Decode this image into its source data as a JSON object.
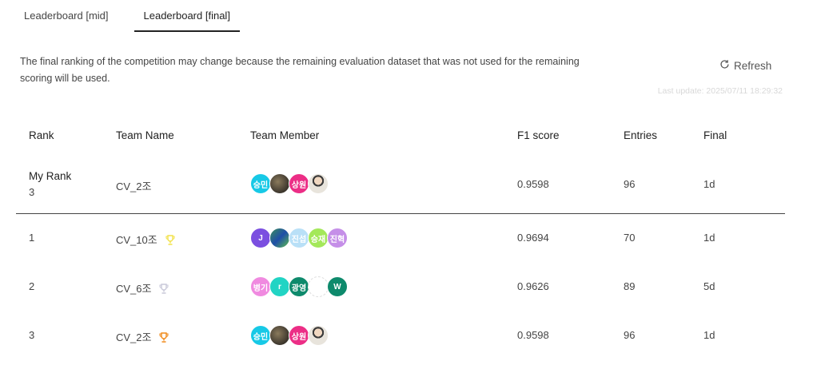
{
  "tabs": [
    {
      "label": "Leaderboard [mid]"
    },
    {
      "label": "Leaderboard [final]"
    }
  ],
  "notice": "The final ranking of the competition may change because the remaining evaluation dataset that was not used for the remaining scoring will be used.",
  "refresh_label": "Refresh",
  "last_update": "Last update: 2025/07/11 18:29:32",
  "columns": {
    "rank": "Rank",
    "team_name": "Team Name",
    "team_member": "Team Member",
    "f1": "F1 score",
    "entries": "Entries",
    "final": "Final"
  },
  "my_rank": {
    "label": "My Rank",
    "rank": "3",
    "team": "CV_2조",
    "members": [
      {
        "text": "승민",
        "color": "#17c9e6"
      },
      {
        "text": "",
        "color": "photo-dark"
      },
      {
        "text": "상원",
        "color": "#ec2e86"
      },
      {
        "text": "",
        "color": "photo-man"
      }
    ],
    "f1": "0.9598",
    "entries": "96",
    "final": "1d"
  },
  "rows": [
    {
      "rank": "1",
      "team": "CV_10조",
      "trophy_color": "#f2e24a",
      "members": [
        {
          "text": "J",
          "color": "#7b4fe0"
        },
        {
          "text": "",
          "color": "photo-green"
        },
        {
          "text": "진섭",
          "color": "#b9e0f7"
        },
        {
          "text": "승재",
          "color": "#a4e85a"
        },
        {
          "text": "진혁",
          "color": "#c58fe8"
        }
      ],
      "f1": "0.9694",
      "entries": "70",
      "final": "1d"
    },
    {
      "rank": "2",
      "team": "CV_6조",
      "trophy_color": "#c9c9d9",
      "members": [
        {
          "text": "병기",
          "color": "#f08ae0"
        },
        {
          "text": "r",
          "color": "#22d4c4"
        },
        {
          "text": "광영",
          "color": "#0e8a6c"
        },
        {
          "text": "",
          "color": "photo-blank"
        },
        {
          "text": "W",
          "color": "#0e8a6c"
        }
      ],
      "f1": "0.9626",
      "entries": "89",
      "final": "5d"
    },
    {
      "rank": "3",
      "team": "CV_2조",
      "trophy_color": "#f08a1a",
      "members": [
        {
          "text": "승민",
          "color": "#17c9e6"
        },
        {
          "text": "",
          "color": "photo-dark"
        },
        {
          "text": "상원",
          "color": "#ec2e86"
        },
        {
          "text": "",
          "color": "photo-man"
        }
      ],
      "f1": "0.9598",
      "entries": "96",
      "final": "1d"
    }
  ]
}
